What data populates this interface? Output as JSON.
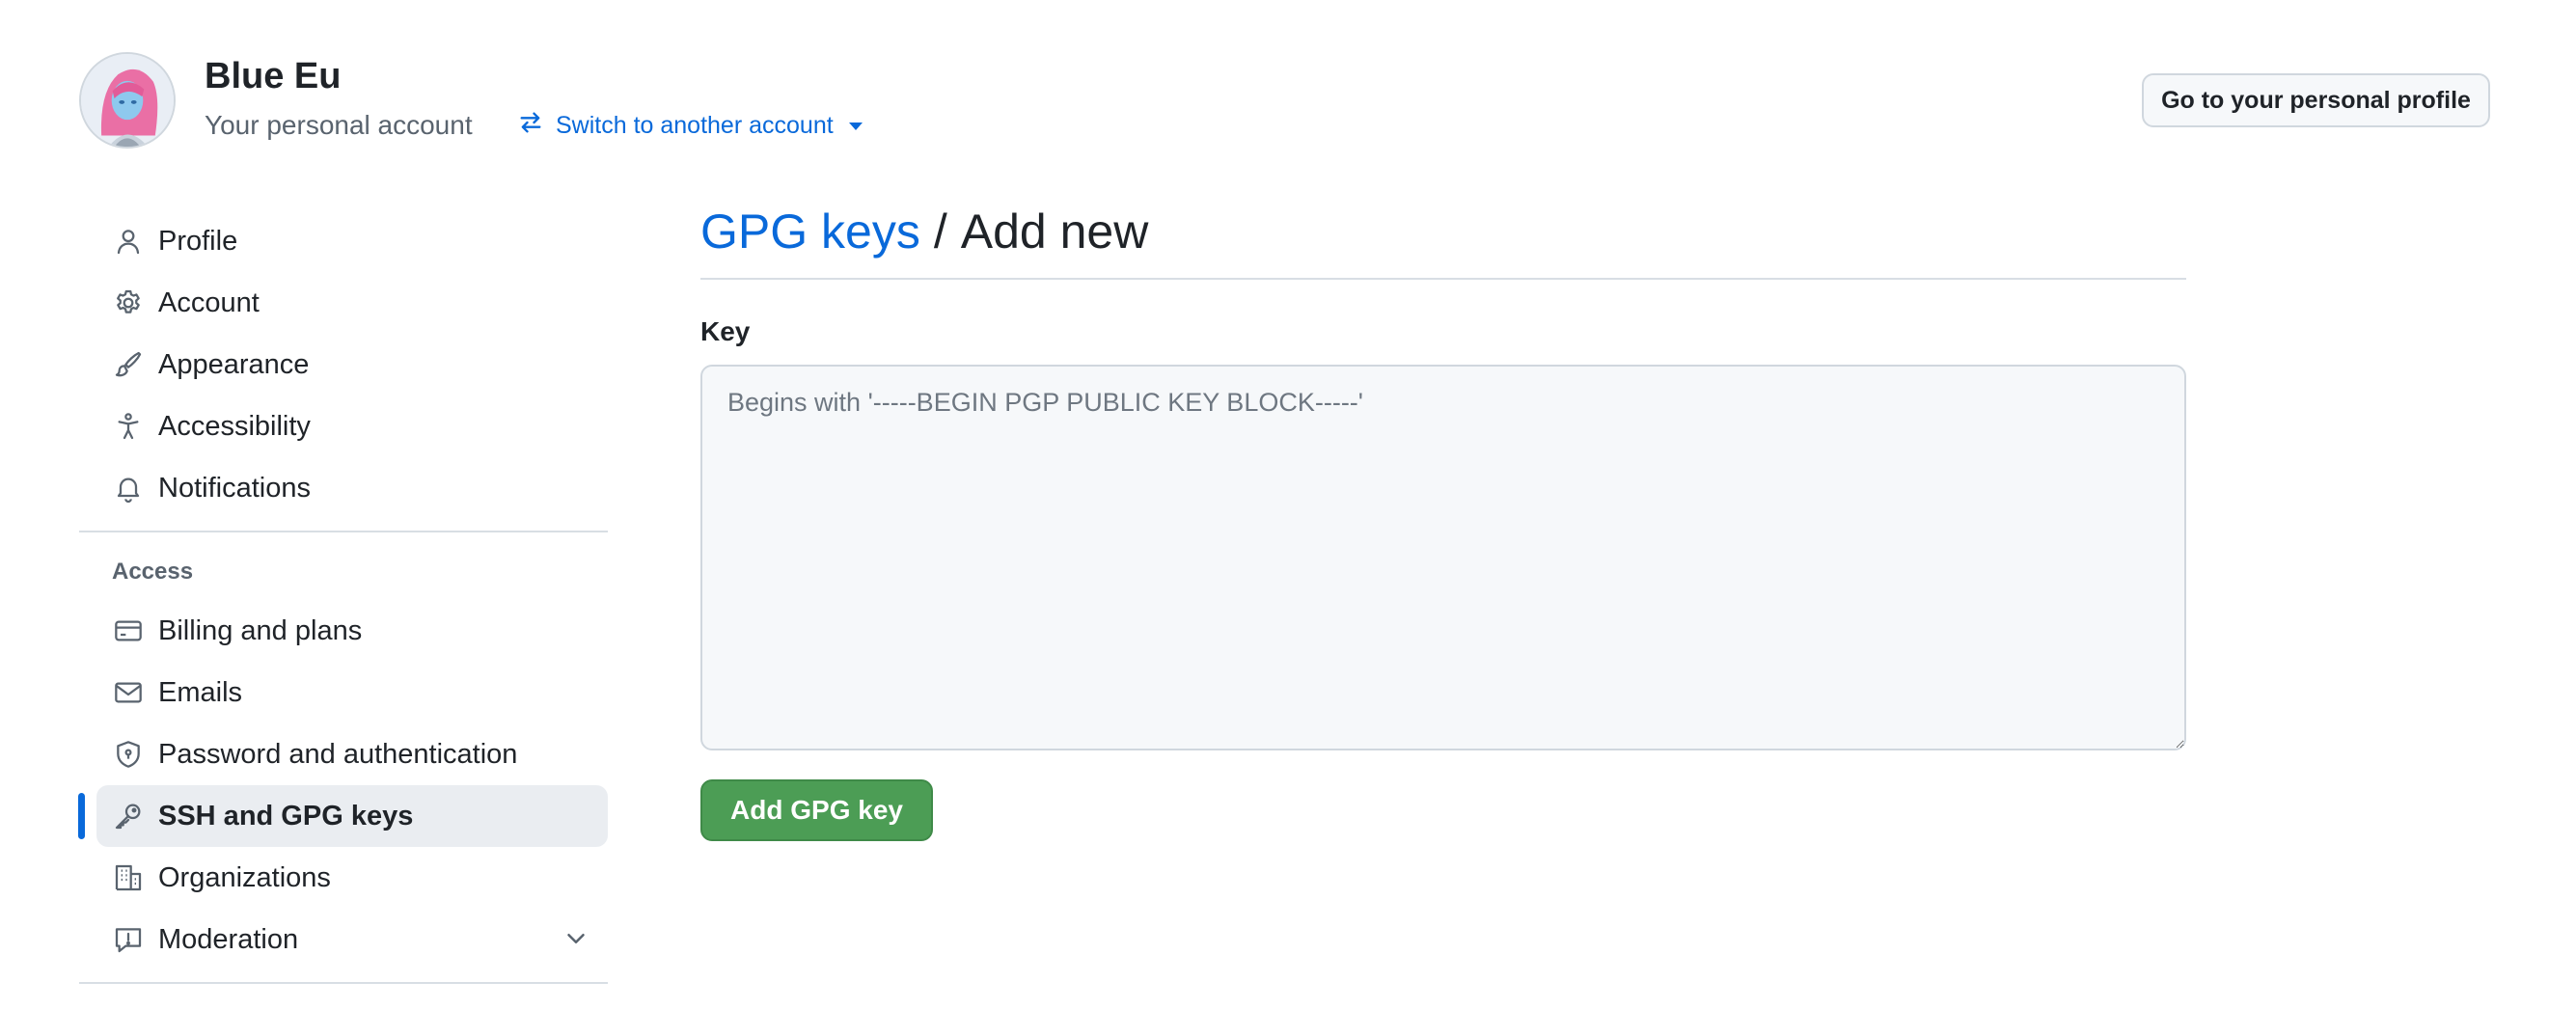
{
  "header": {
    "account_name": "Blue Eu",
    "account_subtitle": "Your personal account",
    "switch_label": "Switch to another account",
    "profile_button": "Go to your personal profile"
  },
  "sidebar": {
    "items": [
      {
        "label": "Profile",
        "icon": "person-icon"
      },
      {
        "label": "Account",
        "icon": "gear-icon"
      },
      {
        "label": "Appearance",
        "icon": "paintbrush-icon"
      },
      {
        "label": "Accessibility",
        "icon": "accessibility-icon"
      },
      {
        "label": "Notifications",
        "icon": "bell-icon"
      }
    ],
    "access_section_label": "Access",
    "access_items": [
      {
        "label": "Billing and plans",
        "icon": "credit-card-icon"
      },
      {
        "label": "Emails",
        "icon": "mail-icon"
      },
      {
        "label": "Password and authentication",
        "icon": "shield-lock-icon"
      },
      {
        "label": "SSH and GPG keys",
        "icon": "key-icon",
        "active": true
      },
      {
        "label": "Organizations",
        "icon": "organization-icon"
      },
      {
        "label": "Moderation",
        "icon": "report-icon",
        "expandable": true
      }
    ]
  },
  "main": {
    "breadcrumb_link": "GPG keys",
    "breadcrumb_separator": "/",
    "breadcrumb_current": "Add new",
    "key_label": "Key",
    "key_placeholder": "Begins with '-----BEGIN PGP PUBLIC KEY BLOCK-----'",
    "key_value": "",
    "submit_label": "Add GPG key"
  },
  "colors": {
    "accent": "#0969da",
    "primary_button": "#4c9d55",
    "active_indicator": "#0969da"
  }
}
